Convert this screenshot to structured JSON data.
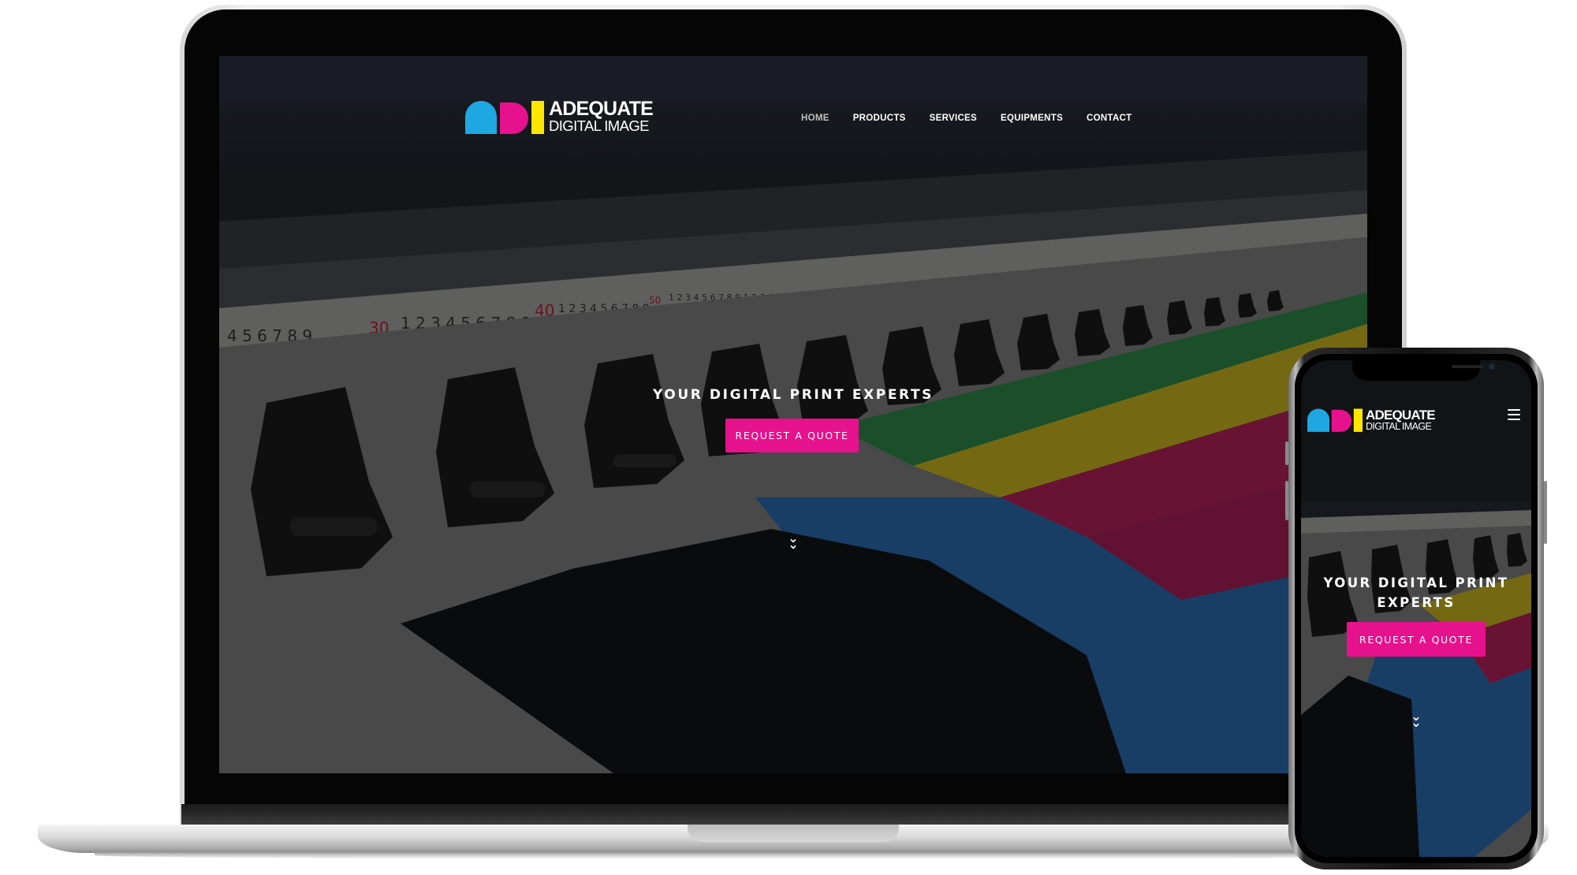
{
  "brand": {
    "name": "ADEQUATE",
    "sub": "DIGITAL IMAGE",
    "colors": {
      "cyan": "#1ea7e1",
      "magenta": "#e6118c",
      "yellow": "#ffe600"
    }
  },
  "nav": {
    "items": [
      {
        "label": "HOME",
        "active": true
      },
      {
        "label": "PRODUCTS",
        "active": false
      },
      {
        "label": "SERVICES",
        "active": false
      },
      {
        "label": "EQUIPMENTS",
        "active": false
      },
      {
        "label": "CONTACT",
        "active": false
      }
    ]
  },
  "hero": {
    "title": "YOUR DIGITAL PRINT EXPERTS",
    "cta_label": "REQUEST A QUOTE",
    "scroll_icon": "double-chevron-down-icon",
    "accent_color": "#e6118c"
  },
  "mobile": {
    "title": "YOUR DIGITAL PRINT EXPERTS",
    "cta_label": "REQUEST A QUOTE",
    "menu_icon": "hamburger-menu-icon"
  }
}
